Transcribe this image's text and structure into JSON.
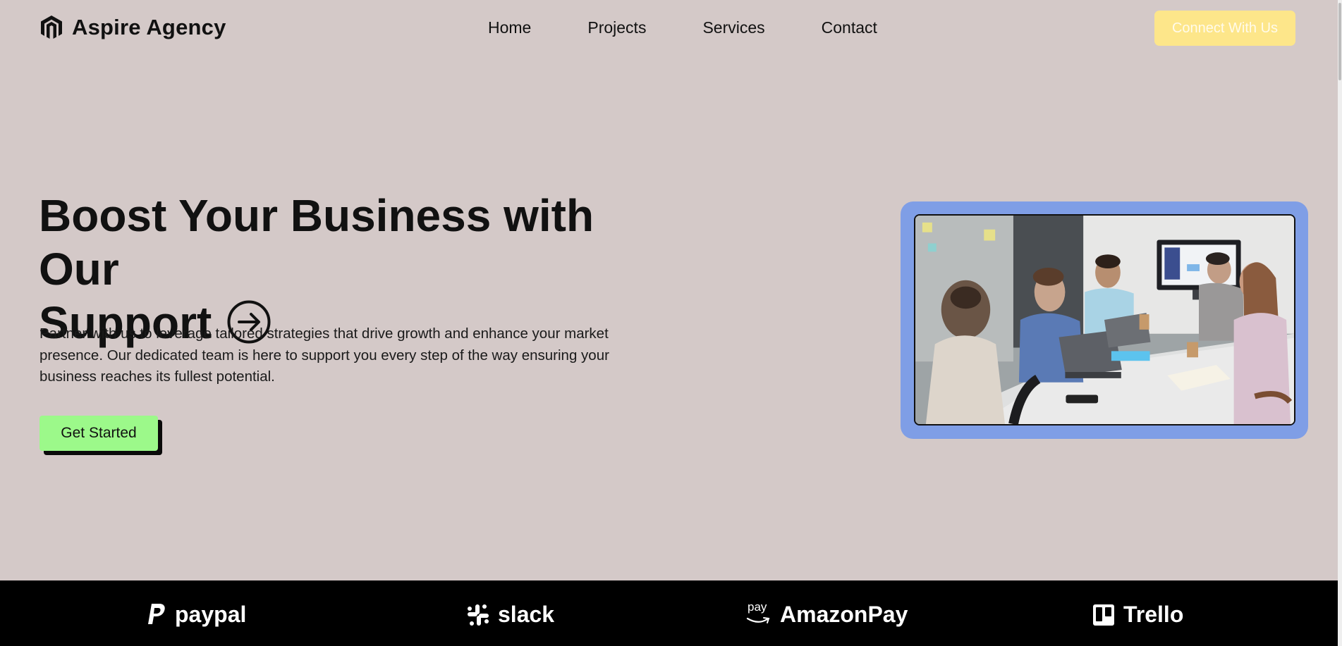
{
  "header": {
    "brand_name": "Aspire Agency",
    "brand_icon": "hexagon-m-logo-icon",
    "nav": [
      "Home",
      "Projects",
      "Services",
      "Contact"
    ],
    "cta_label": "Connect With Us"
  },
  "hero": {
    "title_line1": "Boost Your Business with Our",
    "title_line2": "Support",
    "title_icon": "arrow-right-circle-icon",
    "description": "Partner with us to leverage tailored strategies that drive growth and enhance your market presence. Our dedicated team is here to support you every step of the way ensuring your business reaches its fullest potential.",
    "button_label": "Get Started",
    "image_subject": "team-meeting-photo"
  },
  "partners": [
    {
      "name": "paypal",
      "icon": "paypal-icon"
    },
    {
      "name": "slack",
      "icon": "slack-icon"
    },
    {
      "name": "AmazonPay",
      "icon": "amazon-pay-icon",
      "icon_text": "pay"
    },
    {
      "name": "Trello",
      "icon": "trello-icon"
    }
  ],
  "colors": {
    "page_background": "#d4c9c8",
    "cta_background": "#fde68a",
    "button_background": "#9cf98a",
    "image_frame": "#7f9ee6",
    "logos_background": "#000000"
  }
}
